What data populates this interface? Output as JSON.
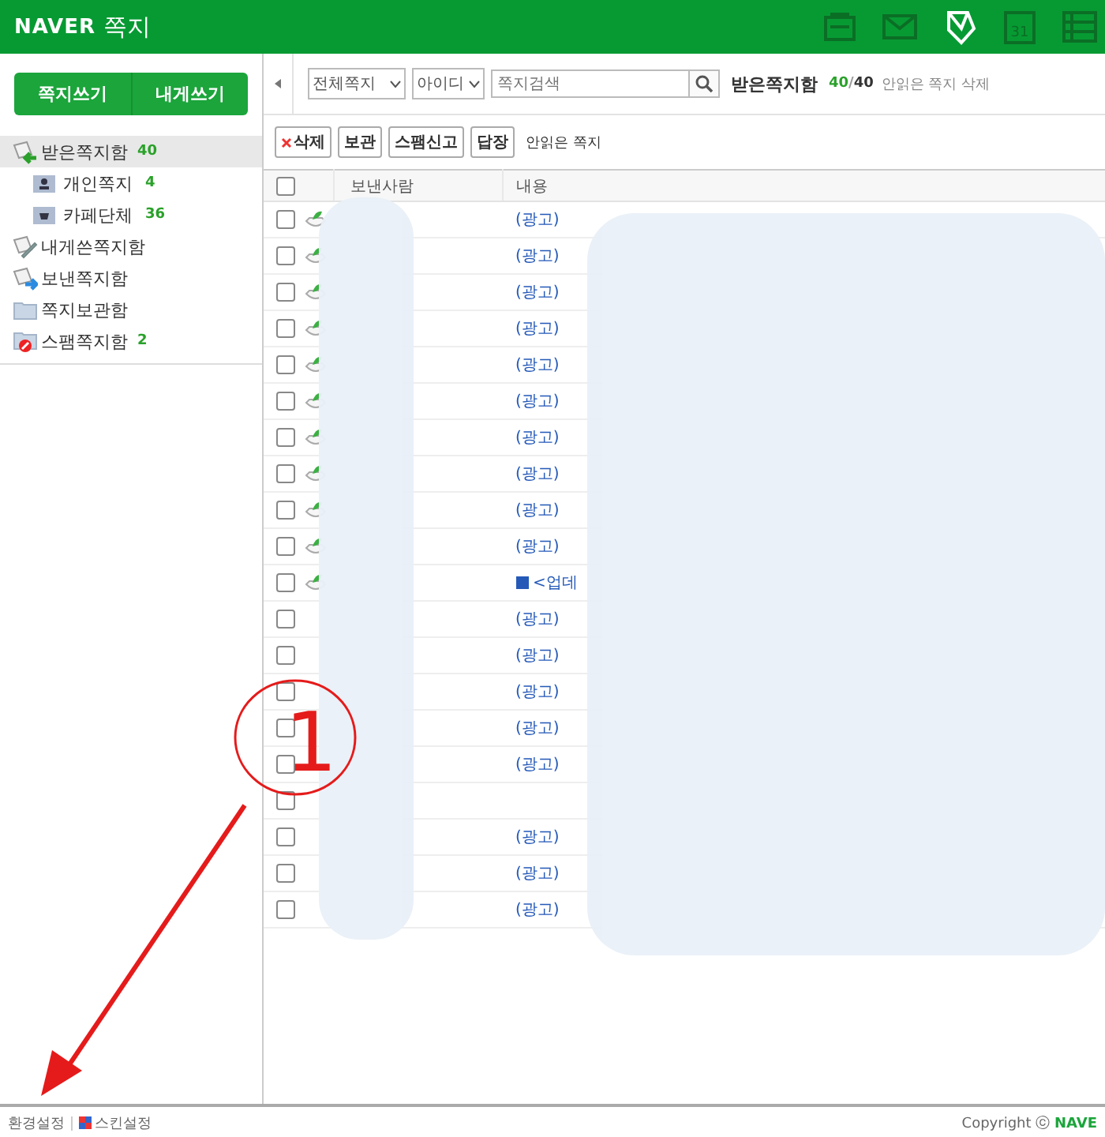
{
  "header": {
    "logo": "NAVER",
    "title": "쪽지",
    "nav": [
      {
        "kind": "address",
        "selected": false
      },
      {
        "kind": "mail",
        "selected": false
      },
      {
        "kind": "note",
        "selected": true
      },
      {
        "kind": "calendar",
        "label": "31",
        "selected": false
      },
      {
        "kind": "list",
        "selected": false
      }
    ]
  },
  "sidebar": {
    "buttons": [
      "쪽지쓰기",
      "내게쓰기"
    ],
    "folders": [
      {
        "kind": "inbox",
        "label": "받은쪽지함",
        "count": "40",
        "selected": true,
        "children": [
          {
            "kind": "person",
            "label": "개인쪽지",
            "count": "4",
            "selected": false
          },
          {
            "kind": "cafe",
            "label": "카페단체",
            "count": "36",
            "selected": false
          }
        ]
      },
      {
        "kind": "self",
        "label": "내게쓴쪽지함",
        "selected": false
      },
      {
        "kind": "sent",
        "label": "보낸쪽지함",
        "selected": false
      },
      {
        "kind": "folder",
        "label": "쪽지보관함",
        "selected": false
      },
      {
        "kind": "spam",
        "label": "스팸쪽지함",
        "count": "2",
        "selected": false
      }
    ]
  },
  "search": {
    "filter": "전체쪽지",
    "field": "아이디",
    "placeholder": "쪽지검색",
    "folder": "받은쪽지함",
    "unread": "40",
    "separator": "/",
    "total": "40",
    "delete_unread": "안읽은 쪽지 삭제"
  },
  "actions": [
    {
      "kind": "delete",
      "label": "삭제"
    },
    {
      "kind": "plain",
      "label": "보관"
    },
    {
      "kind": "plain",
      "label": "스팸신고"
    },
    {
      "kind": "plain",
      "label": "답장"
    }
  ],
  "unread_filter": "안읽은 쪽지",
  "table": {
    "all_checked": false,
    "columns": [
      "보낸사람",
      "내용"
    ],
    "rows": [
      {
        "checked": false,
        "read": true,
        "subject": "(광고)"
      },
      {
        "checked": false,
        "read": true,
        "subject": "(광고)"
      },
      {
        "checked": false,
        "read": true,
        "subject": "(광고)"
      },
      {
        "checked": false,
        "read": true,
        "subject": "(광고)"
      },
      {
        "checked": false,
        "read": true,
        "subject": "(광고)"
      },
      {
        "checked": false,
        "read": true,
        "subject": "(광고)"
      },
      {
        "checked": false,
        "read": true,
        "subject": "(광고)"
      },
      {
        "checked": false,
        "read": true,
        "subject": "(광고)"
      },
      {
        "checked": false,
        "read": true,
        "subject": "(광고)"
      },
      {
        "checked": false,
        "read": true,
        "subject": "(광고)"
      },
      {
        "checked": false,
        "read": true,
        "notice": true,
        "subject": "<업데"
      },
      {
        "checked": false,
        "subject": "(광고)"
      },
      {
        "checked": false,
        "subject": "(광고)"
      },
      {
        "checked": false,
        "subject": "(광고)"
      },
      {
        "checked": false,
        "subject": "(광고)"
      },
      {
        "checked": false,
        "subject": "(광고)"
      },
      {
        "checked": false
      },
      {
        "checked": false,
        "subject": "(광고)"
      },
      {
        "checked": false,
        "subject": "(광고)"
      },
      {
        "checked": false,
        "subject": "(광고)"
      }
    ]
  },
  "footer": {
    "links": [
      "환경설정",
      "스킨설정"
    ],
    "copyright": "Copyright ⓒ **NAVE**"
  },
  "annotation": {
    "label": "1"
  }
}
